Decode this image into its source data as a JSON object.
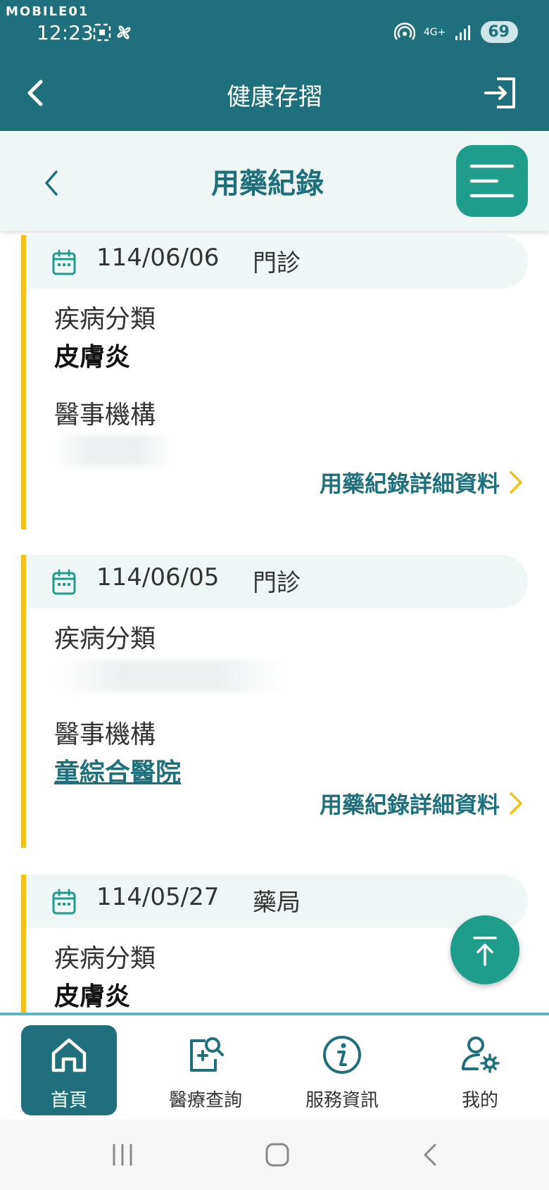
{
  "status_bar": {
    "watermark": "MOBILE01",
    "time": "12:23",
    "network": "4G+",
    "battery": "69"
  },
  "app_bar": {
    "title": "健康存摺"
  },
  "sub_header": {
    "title": "用藥紀錄"
  },
  "records": [
    {
      "date": "114/06/06",
      "type": "門診",
      "disease_label": "疾病分類",
      "disease_value": "皮膚炎",
      "institution_label": "醫事機構",
      "institution_value": "",
      "detail_link": "用藥紀錄詳細資料"
    },
    {
      "date": "114/06/05",
      "type": "門診",
      "disease_label": "疾病分類",
      "disease_value": "",
      "institution_label": "醫事機構",
      "institution_value": "童綜合醫院",
      "detail_link": "用藥紀錄詳細資料"
    },
    {
      "date": "114/05/27",
      "type": "藥局",
      "disease_label": "疾病分類",
      "disease_value": "皮膚炎"
    }
  ],
  "bottom_nav": {
    "items": [
      {
        "label": "首頁",
        "icon": "home-icon",
        "active": true
      },
      {
        "label": "醫療查詢",
        "icon": "medical-search-icon",
        "active": false
      },
      {
        "label": "服務資訊",
        "icon": "info-icon",
        "active": false
      },
      {
        "label": "我的",
        "icon": "user-settings-icon",
        "active": false
      }
    ]
  },
  "colors": {
    "primary": "#1f6f7c",
    "accent": "#1f9d8c",
    "card_bar": "#f3c11b",
    "header_bg": "#eef7f6"
  }
}
